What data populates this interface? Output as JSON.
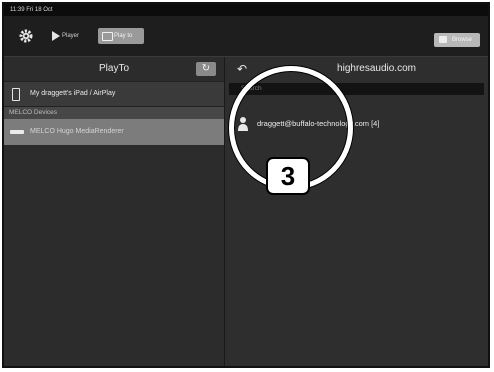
{
  "status_bar": {
    "time": "11:39 Fri 18 Oct"
  },
  "toolbar": {
    "player_label": "Player",
    "playto_label": "Play to",
    "browse_label": "Browse"
  },
  "left_pane": {
    "title": "PlayTo",
    "airplay_device": "My draggett's iPad / AirPlay",
    "section_header": "MELCO Devices",
    "renderer": "MELCO Hugo MediaRenderer"
  },
  "right_pane": {
    "title": "highresaudio.com",
    "search_placeholder": "Search",
    "account": "draggett@buffalo-technology.com [4]"
  },
  "callout": {
    "number": "3"
  },
  "colors": {
    "background": "#2a2a2a",
    "selected_row": "#7c7c7c",
    "callout": "#ffffff"
  }
}
